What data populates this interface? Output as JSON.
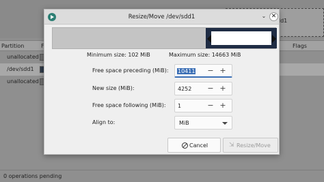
{
  "background": {
    "preview_label": "dd1",
    "columns": [
      "Partition",
      "F",
      "Flags"
    ],
    "rows": [
      {
        "partition": "unallocated",
        "selected": false
      },
      {
        "partition": "/dev/sdd1",
        "selected": true
      },
      {
        "partition": "unallocated",
        "selected": false
      }
    ],
    "status": "0 operations pending"
  },
  "dialog": {
    "title": "Resize/Move /dev/sdd1",
    "min_size": "Minimum size: 102 MiB",
    "max_size": "Maximum size: 14663 MiB",
    "fields": {
      "preceding_label": "Free space preceding (MiB):",
      "preceding_value": "10411",
      "new_size_label": "New size (MiB):",
      "new_size_value": "4252",
      "following_label": "Free space following (MiB):",
      "following_value": "1",
      "align_label": "Align to:",
      "align_value": "MiB"
    },
    "buttons": {
      "cancel": "Cancel",
      "resize": "Resize/Move"
    },
    "colors": {
      "partition_used": "#1f2c44",
      "accent": "#3a6eb5"
    }
  }
}
